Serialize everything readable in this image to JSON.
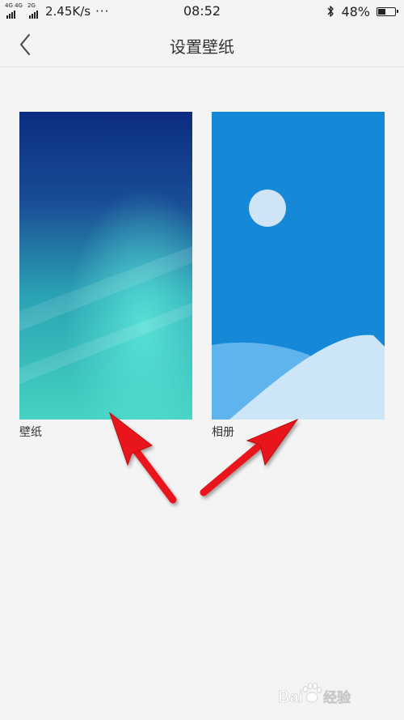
{
  "status_bar": {
    "network_primary": "4G 4G",
    "network_secondary": "2G",
    "speed": "2.45K/s",
    "overflow_icon": "more-dots-icon",
    "time": "08:52",
    "bluetooth_icon": "bluetooth-icon",
    "battery_percent": "48%",
    "battery_level": 0.48
  },
  "header": {
    "back_icon": "chevron-left-icon",
    "title": "设置壁纸"
  },
  "options": [
    {
      "label": "壁纸",
      "thumbnail": "ocean-gradient-wallpaper"
    },
    {
      "label": "相册",
      "thumbnail": "album-landscape-icon"
    }
  ],
  "annotations": {
    "arrow_color": "#e8151b",
    "count": 2
  },
  "watermark": {
    "text": "Bai 经验",
    "logo": "baidu-paw-logo"
  },
  "colors": {
    "background": "#f4f4f4",
    "album_blue": "#1688d8"
  }
}
